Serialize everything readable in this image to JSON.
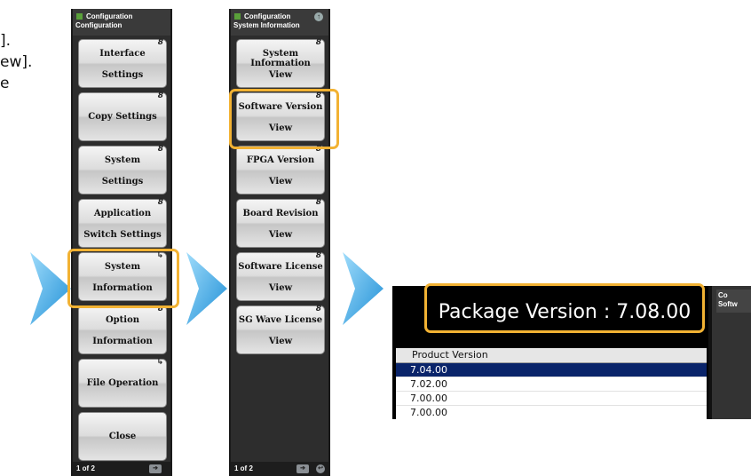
{
  "instructions": {
    "lines": [
      "].",
      "ew].",
      "e"
    ]
  },
  "panel1": {
    "header_title": "Configuration",
    "header_sub": "Configuration",
    "keys": [
      {
        "l1": "Interface",
        "l2": "Settings",
        "mark": "8"
      },
      {
        "one": "Copy Settings",
        "mark": "8"
      },
      {
        "l1": "System",
        "l2": "Settings",
        "mark": "8"
      },
      {
        "l1": "Application",
        "l2": "Switch Settings",
        "mark": "8"
      },
      {
        "l1": "System",
        "l2": "Information",
        "mark": "↳"
      },
      {
        "l1": "Option",
        "l2": "Information",
        "mark": "8"
      },
      {
        "one": "File Operation",
        "mark": "↳"
      },
      {
        "one": "Close",
        "mark": ""
      }
    ],
    "footer_page": "1 of 2"
  },
  "panel2": {
    "header_title": "Configuration",
    "header_sub": "System Information",
    "keys": [
      {
        "l1": "System Information",
        "l2": "View",
        "mark": "8"
      },
      {
        "l1": "Software Version",
        "l2": "View",
        "mark": "8"
      },
      {
        "l1": "FPGA Version",
        "l2": "View",
        "mark": "8"
      },
      {
        "l1": "Board Revision",
        "l2": "View",
        "mark": "8"
      },
      {
        "l1": "Software License",
        "l2": "View",
        "mark": "8"
      },
      {
        "l1": "SG Wave License",
        "l2": "View",
        "mark": "8"
      }
    ],
    "footer_page": "1 of 2"
  },
  "version_screen": {
    "package_label": "Package Version : 7.08.00",
    "column_header": "Product Version",
    "rows": [
      "7.04.00",
      "7.02.00",
      "7.00.00",
      "7.00.00"
    ],
    "side_title": "Co",
    "side_sub": "Softw"
  },
  "colors": {
    "highlight": "#f2b233",
    "arrow": "#3aa3e0",
    "selected_row": "#0a246a"
  }
}
